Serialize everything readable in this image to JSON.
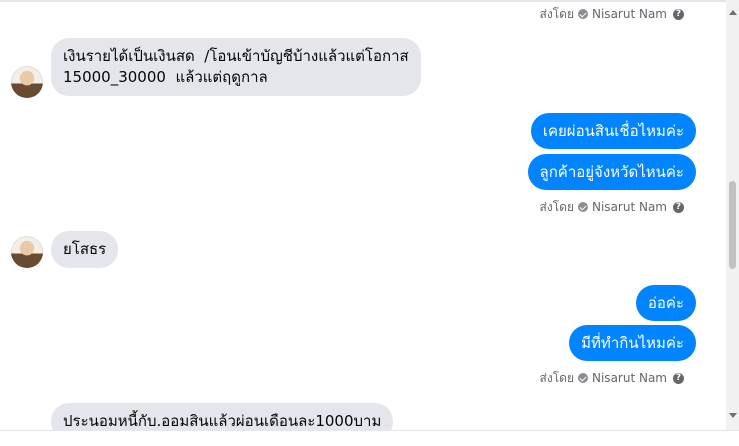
{
  "sent_by": {
    "prefix": "ส่งโดย",
    "name": "Nisarut Nam",
    "info": "?"
  },
  "messages": {
    "m1": "เงินรายได้เป็นเงินสด  /โอนเข้าบัญชีบ้างแล้วแต่โอกาส\n15000_30000  แล้วแต่ฤดูกาล",
    "m2": "เคยผ่อนสินเชื่อไหมค่ะ",
    "m3": "ลูกค้าอยู่จังหวัดไหนค่ะ",
    "m4": "ยโสธร",
    "m5": "อ่อค่ะ",
    "m6": "มีที่ทำกินไหมค่ะ",
    "m7": "ประนอมหนี้กับ.ออมสินแล้วผ่อนเดือนละ1000บาม"
  },
  "colors": {
    "outgoing": "#0084ff",
    "incoming": "#e4e6eb",
    "meta_text": "#65676b"
  }
}
